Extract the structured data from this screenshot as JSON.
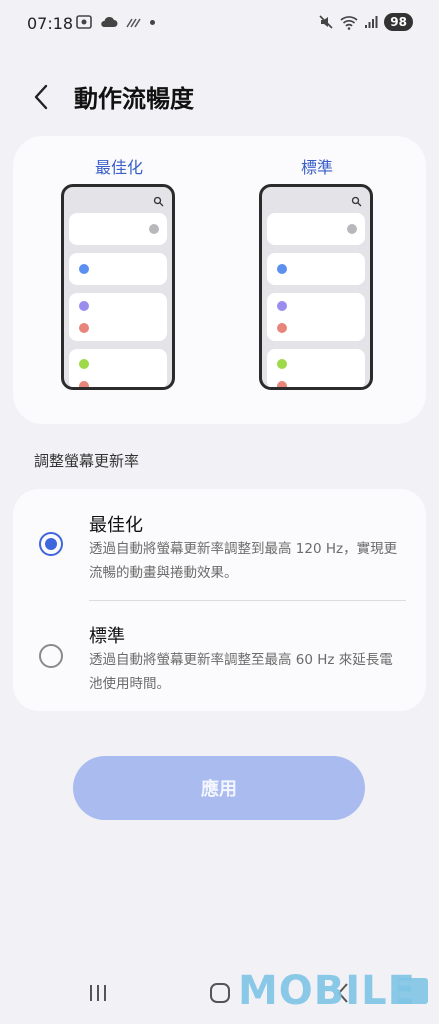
{
  "status_bar": {
    "time": "07:18",
    "battery": "98",
    "icons_left": [
      "screenshot-icon",
      "cloud-icon",
      "signal-slash-icon",
      "dot-icon"
    ],
    "icons_right": [
      "mute-icon",
      "wifi-icon",
      "cellular-icon",
      "battery-icon"
    ]
  },
  "header": {
    "title": "動作流暢度",
    "back_icon": "back-chevron-icon"
  },
  "preview": {
    "optimized_label": "最佳化",
    "standard_label": "標準",
    "dot_colors": {
      "blue": "#5b8ff0",
      "purple": "#9b8cf0",
      "red": "#e8857a",
      "green": "#9ed94a"
    }
  },
  "section_label": "調整螢幕更新率",
  "options": [
    {
      "title": "最佳化",
      "description": "透過自動將螢幕更新率調整到最高 120 Hz，實現更流暢的動畫與捲動效果。",
      "selected": true
    },
    {
      "title": "標準",
      "description": "透過自動將螢幕更新率調整至最高 60 Hz 來延長電池使用時間。",
      "selected": false
    }
  ],
  "apply_label": "應用",
  "accent_color": "#3e66dd",
  "watermark": "MOBILE"
}
